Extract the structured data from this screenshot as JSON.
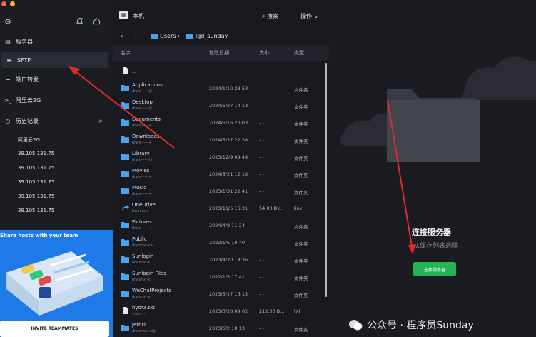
{
  "sidebar": {
    "nav": [
      {
        "label": "服务器",
        "icon": "server-icon"
      },
      {
        "label": "SFTP",
        "icon": "folder-icon"
      },
      {
        "label": "端口转发",
        "icon": "forward-icon"
      },
      {
        "label": "阿里云2G",
        "icon": "terminal-icon"
      }
    ],
    "history_label": "历史记录",
    "history": [
      "阿里云2G",
      "39.105.131.75",
      "39.105.131.75",
      "39.105.131.75",
      "39.105.131.75",
      "39.105.131.75"
    ],
    "promo_title": "Share hosts with your team",
    "promo_button": "INVITE TEAMMATES"
  },
  "files": {
    "header_title": "本机",
    "search_label": "搜索",
    "ops_label": "操作",
    "breadcrumb": [
      "Users",
      "lgd_sunday"
    ],
    "columns": {
      "name": "名字",
      "date": "修改日期",
      "size": "大小",
      "type": "类型"
    },
    "rows": [
      {
        "name": "..",
        "perm": "",
        "date": "",
        "size": "",
        "type": "",
        "kind": "file"
      },
      {
        "name": "Applications",
        "perm": "drwx------@",
        "date": "2024/1/10 23:53",
        "size": "- -",
        "type": "文件夹",
        "kind": "folder"
      },
      {
        "name": "Desktop",
        "perm": "drwx------@",
        "date": "2024/5/27 14:13",
        "size": "- -",
        "type": "文件夹",
        "kind": "folder"
      },
      {
        "name": "Documents",
        "perm": "drwx------+",
        "date": "2024/5/16 20:03",
        "size": "- -",
        "type": "文件夹",
        "kind": "folder"
      },
      {
        "name": "Downloads",
        "perm": "drwx------+",
        "date": "2024/5/27 22:38",
        "size": "- -",
        "type": "文件夹",
        "kind": "folder"
      },
      {
        "name": "Library",
        "perm": "drwx------@",
        "date": "2023/12/9 09:48",
        "size": "- -",
        "type": "文件夹",
        "kind": "folder"
      },
      {
        "name": "Movies",
        "perm": "drwx------+",
        "date": "2024/5/21 12:18",
        "size": "- -",
        "type": "文件夹",
        "kind": "folder"
      },
      {
        "name": "Music",
        "perm": "drwx------+",
        "date": "2023/1/31 22:41",
        "size": "- -",
        "type": "文件夹",
        "kind": "folder"
      },
      {
        "name": "OneDrive",
        "perm": "lrwxr-xr-x",
        "date": "2023/11/5 16:31",
        "size": "54.00 By...",
        "type": "link",
        "kind": "link"
      },
      {
        "name": "Pictures",
        "perm": "drwx------+",
        "date": "2024/4/8 11:24",
        "size": "- -",
        "type": "文件夹",
        "kind": "folder"
      },
      {
        "name": "Public",
        "perm": "drwxr-xr-x+",
        "date": "2022/1/5 10:40",
        "size": "- -",
        "type": "文件夹",
        "kind": "folder"
      },
      {
        "name": "Sunlogin",
        "perm": "drwxr-xr-x",
        "date": "2023/4/20 18:36",
        "size": "- -",
        "type": "文件夹",
        "kind": "folder"
      },
      {
        "name": "Sunlogin Files",
        "perm": "drwxr-xr-x",
        "date": "2022/1/5 17:41",
        "size": "- -",
        "type": "文件夹",
        "kind": "folder"
      },
      {
        "name": "WeChatProjects",
        "perm": "drwxr-xr-x",
        "date": "2023/3/17 16:15",
        "size": "- -",
        "type": "文件夹",
        "kind": "folder"
      },
      {
        "name": "hydra.txt",
        "perm": "-rw-r--r--",
        "date": "2023/3/28 09:02",
        "size": "212.00 B...",
        "type": "txt",
        "kind": "file"
      },
      {
        "name": "jetbra",
        "perm": "drwxrwxr-x@",
        "date": "2023/6/2 10:13",
        "size": "- -",
        "type": "文件夹",
        "kind": "folder"
      }
    ]
  },
  "right": {
    "title": "连接服务器",
    "subtitle": "从保存列表选择",
    "button": "选择服务器"
  },
  "watermark": "公众号 · 程序员Sunday",
  "colors": {
    "accent_blue": "#4aa3f0",
    "green": "#23b456",
    "arrow_red": "#e02b2b",
    "promo_blue": "#1e7ae6"
  }
}
